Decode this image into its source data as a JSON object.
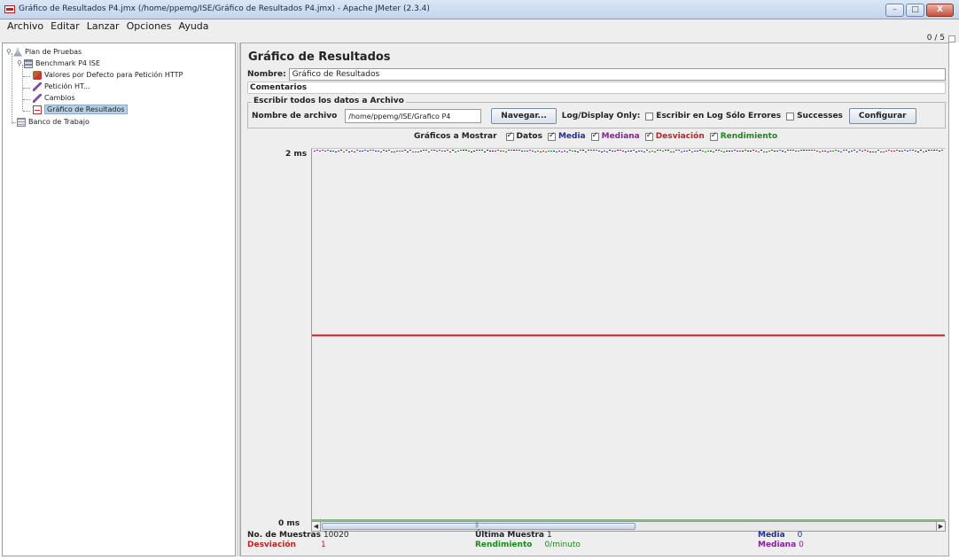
{
  "window": {
    "title": "Gráfico de Resultados P4.jmx (/home/ppemg/ISE/Gráfico de Resultados P4.jmx) - Apache JMeter (2.3.4)",
    "minimize": "–",
    "maximize": "□",
    "close": "X"
  },
  "menubar": {
    "items": [
      {
        "label": "Archivo"
      },
      {
        "label": "Editar"
      },
      {
        "label": "Lanzar"
      },
      {
        "label": "Opciones"
      },
      {
        "label": "Ayuda"
      }
    ]
  },
  "counter": "0 / 5",
  "tree": {
    "items": [
      {
        "label": "Plan de Pruebas",
        "icon": "flask-icon"
      },
      {
        "label": "Benchmark P4 ISE",
        "icon": "thread-group-icon"
      },
      {
        "label": "Valores por Defecto para Petición HTTP",
        "icon": "config-defaults-icon"
      },
      {
        "label": "Petición HT...",
        "icon": "sampler-pipette-icon"
      },
      {
        "label": "Cambios",
        "icon": "sampler-pipette-icon"
      },
      {
        "label": "Gráfico de Resultados",
        "icon": "graph-listener-icon",
        "selected": true
      },
      {
        "label": "Banco de Trabajo",
        "icon": "workbench-icon"
      }
    ]
  },
  "panel": {
    "title": "Gráfico de Resultados",
    "name_label": "Nombre:",
    "name_value": "Gráfico de Resultados",
    "comments_label": "Comentarios",
    "file_group_title": "Escribir todos los datos a Archivo",
    "filename_label": "Nombre de archivo",
    "filename_value": "/home/ppemg/ISE/Grafico P4",
    "browse_button": "Navegar...",
    "log_display_label": "Log/Display Only:",
    "errors_only_label": "Escribir en Log Sólo Errores",
    "errors_only_checked": false,
    "successes_label": "Successes",
    "successes_checked": false,
    "configure_button": "Configurar"
  },
  "graph_options": {
    "title": "Gráficos a Mostrar",
    "items": [
      {
        "label": "Datos",
        "checked": true,
        "color": "#222222"
      },
      {
        "label": "Media",
        "checked": true,
        "color": "#1f2fa0"
      },
      {
        "label": "Mediana",
        "checked": true,
        "color": "#8a1f9a"
      },
      {
        "label": "Desviación",
        "checked": true,
        "color": "#c22020"
      },
      {
        "label": "Rendimiento",
        "checked": true,
        "color": "#1a8a1a"
      }
    ]
  },
  "graph": {
    "y_max_label": "2 ms",
    "y_min_label": "0 ms",
    "y_max": 2,
    "y_min": 0,
    "deviation_value": 1,
    "deviation_color": "#c22020",
    "throughput_color": "#1a8a1a"
  },
  "stats": {
    "samples_label": "No. de Muestras",
    "samples_value": "10020",
    "last_label": "Última Muestra",
    "last_value": "1",
    "average_label": "Media",
    "average_value": "0",
    "deviation_label": "Desviación",
    "deviation_value": "1",
    "throughput_label": "Rendimiento",
    "throughput_value": "0/minuto",
    "median_label": "Mediana",
    "median_value": "0",
    "colors": {
      "default": "#222222",
      "deviation": "#c22020",
      "throughput": "#1a8a1a",
      "average": "#1f2fa0",
      "median": "#8a1f9a"
    }
  }
}
